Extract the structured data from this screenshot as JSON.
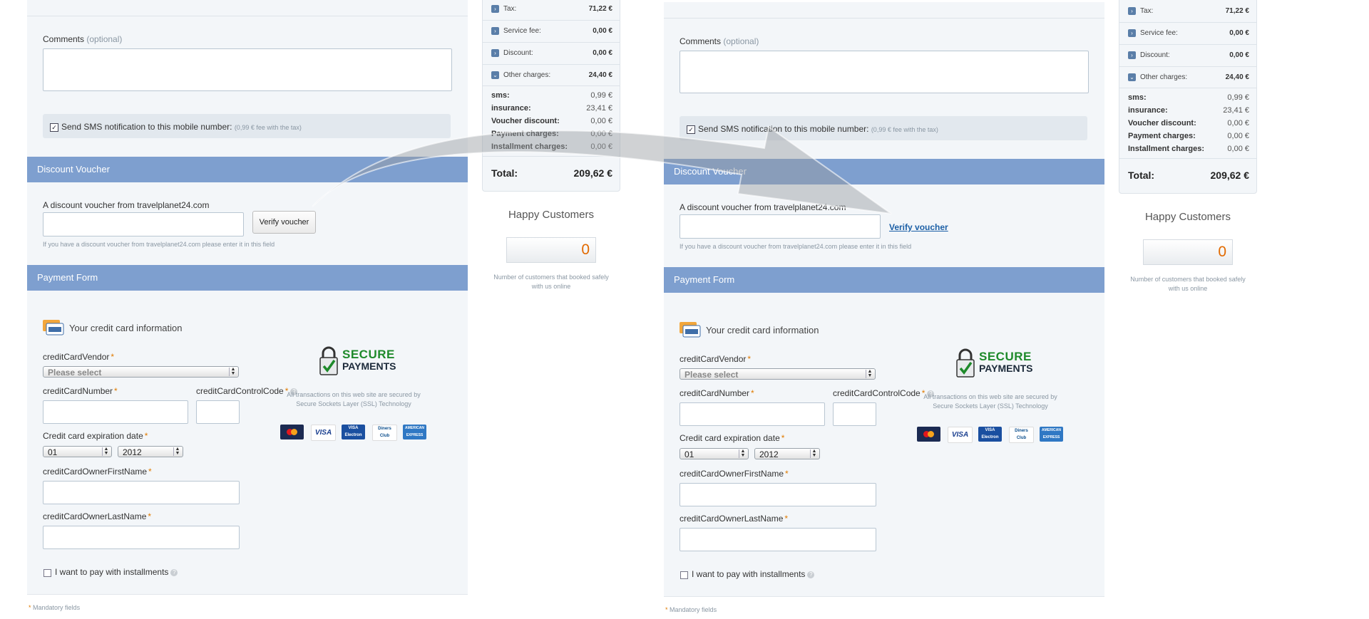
{
  "comments": {
    "label": "Comments",
    "optional": "(optional)"
  },
  "sms": {
    "label": "Send SMS notification to this mobile number:",
    "fee": "(0,99 € fee with the tax)",
    "checked": true
  },
  "discount": {
    "header": "Discount Voucher",
    "label": "A discount voucher from travelplanet24.com",
    "button": "Verify voucher",
    "link": "Verify voucher",
    "hint": "If you have a discount voucher from travelplanet24.com please enter it in this field"
  },
  "payment": {
    "header": "Payment Form",
    "card_info": "Your credit card information",
    "vendor_label": "creditCardVendor",
    "vendor_value": "Please select",
    "number_label": "creditCardNumber",
    "control_label": "creditCardControlCode",
    "expiry_label": "Credit card expiration date",
    "month": "01",
    "year": "2012",
    "first_name_label": "creditCardOwnerFirstName",
    "last_name_label": "creditCardOwnerLastName",
    "installments": "I want to pay with installments",
    "secure_line1": "SECURE",
    "secure_line2": "PAYMENTS",
    "ssl_line1": "All transactions on this web site are secured by",
    "ssl_line2": "Secure Sockets Layer (SSL) Technology",
    "cards": [
      "MasterCard",
      "VISA",
      "VISA Electron",
      "Diners Club",
      "AMERICAN EXPRESS"
    ],
    "mandatory": "Mandatory fields",
    "asterisk": "*"
  },
  "summary": {
    "tax_label": "Tax:",
    "tax_value": "71,22 €",
    "service_label": "Service fee:",
    "service_value": "0,00 €",
    "discount_label": "Discount:",
    "discount_value": "0,00 €",
    "other_label": "Other charges:",
    "other_value": "24,40 €",
    "details": [
      {
        "label": "sms:",
        "value": "0,99 €"
      },
      {
        "label": "insurance:",
        "value": "23,41 €"
      },
      {
        "label": "Voucher discount:",
        "value": "0,00 €"
      },
      {
        "label": "Payment charges:",
        "value": "0,00 €"
      },
      {
        "label": "Installment charges:",
        "value": "0,00 €"
      }
    ],
    "total_label": "Total:",
    "total_value": "209,62 €"
  },
  "happy": {
    "title": "Happy Customers",
    "count": "0",
    "note1": "Number of customers that booked safely",
    "note2": "with us online"
  },
  "colors": {
    "section_header": "#7e9fcf",
    "counter": "#e26a00",
    "secure_green": "#1e8a2a",
    "link": "#1b5fa6"
  }
}
